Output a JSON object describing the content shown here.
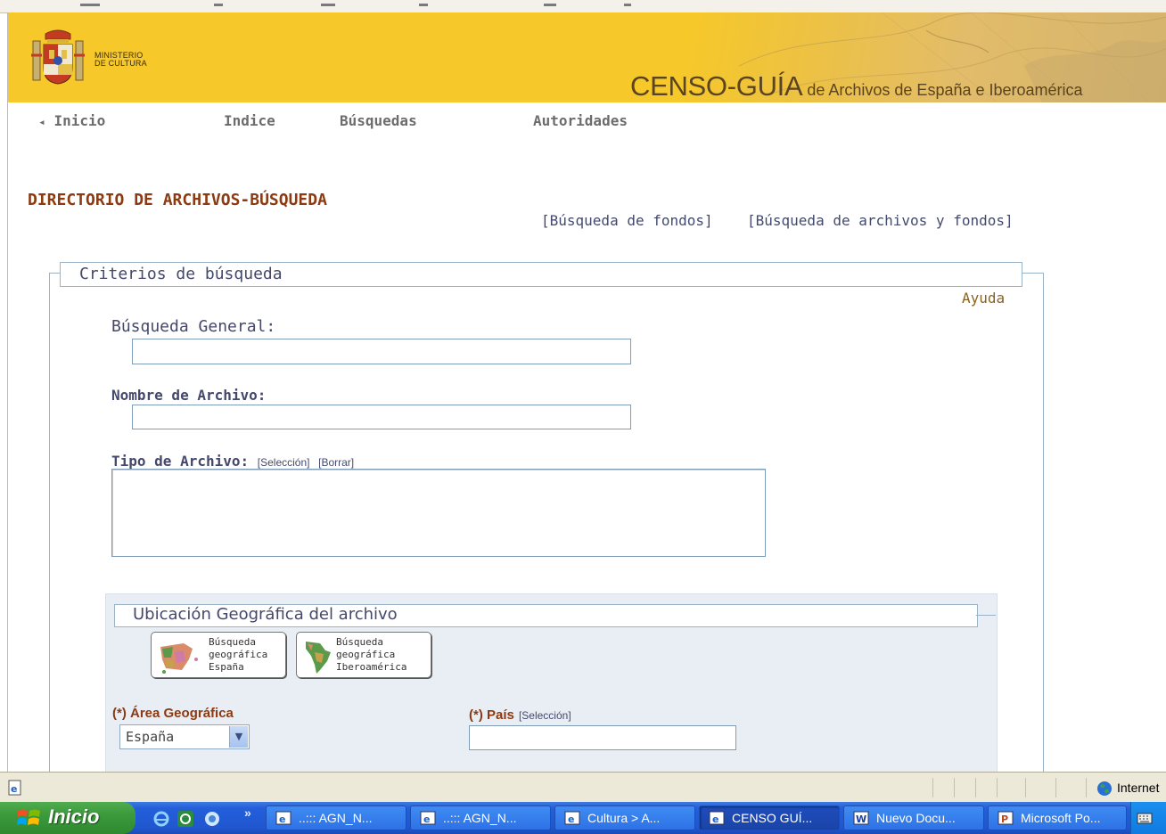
{
  "header": {
    "ministerio_line1": "MINISTERIO",
    "ministerio_line2": "DE CULTURA",
    "title_main": "CENSO-GUÍA",
    "title_sub": " de Archivos de España e Iberoamérica"
  },
  "nav": {
    "inicio": "Inicio",
    "inicio_arrow": "◂",
    "indice": "Indice",
    "busquedas": "Búsquedas",
    "autoridades": "Autoridades"
  },
  "page": {
    "section_title": "DIRECTORIO DE ARCHIVOS-BÚSQUEDA",
    "link_fondos": "[Búsqueda de fondos]",
    "link_archivos_fondos": "[Búsqueda de archivos y fondos]"
  },
  "criterios": {
    "legend": "Criterios de búsqueda",
    "ayuda": "Ayuda",
    "busqueda_general_label": "Búsqueda General:",
    "busqueda_general_value": "",
    "nombre_archivo_label": "Nombre de Archivo:",
    "nombre_archivo_value": "",
    "tipo_archivo_label": "Tipo de Archivo:",
    "tipo_seleccion": "[Selección]",
    "tipo_borrar": "[Borrar]",
    "tipo_archivo_value": ""
  },
  "ubicacion": {
    "legend": "Ubicación Geográfica del archivo",
    "btn_espana": [
      "Búsqueda",
      "geográfica",
      "España"
    ],
    "btn_iberoamerica": [
      "Búsqueda",
      "geográfica",
      "Iberoamérica"
    ],
    "area_label": "(*) Área Geográfica",
    "area_value": "España",
    "pais_label": "(*) País",
    "pais_seleccion": "[Selección]",
    "pais_value": ""
  },
  "statusbar": {
    "zone": "Internet"
  },
  "taskbar": {
    "start": "Inicio",
    "tasks": [
      {
        "label": "..::: AGN_N...",
        "icon": "ie-icon"
      },
      {
        "label": "..::: AGN_N...",
        "icon": "ie-icon"
      },
      {
        "label": "Cultura > A...",
        "icon": "ie-icon"
      },
      {
        "label": "CENSO GUÍ...",
        "icon": "ie-icon",
        "active": true
      },
      {
        "label": "Nuevo Docu...",
        "icon": "word-icon"
      },
      {
        "label": "Microsoft Po...",
        "icon": "powerpoint-icon"
      }
    ],
    "overflow": "»"
  },
  "colors": {
    "banner": "#f6c829",
    "title_brown": "#8b3a12",
    "label_blue": "#44486a",
    "fieldset_border": "#9ab3c6",
    "taskbar": "#245edb",
    "start_green": "#3c993c"
  }
}
